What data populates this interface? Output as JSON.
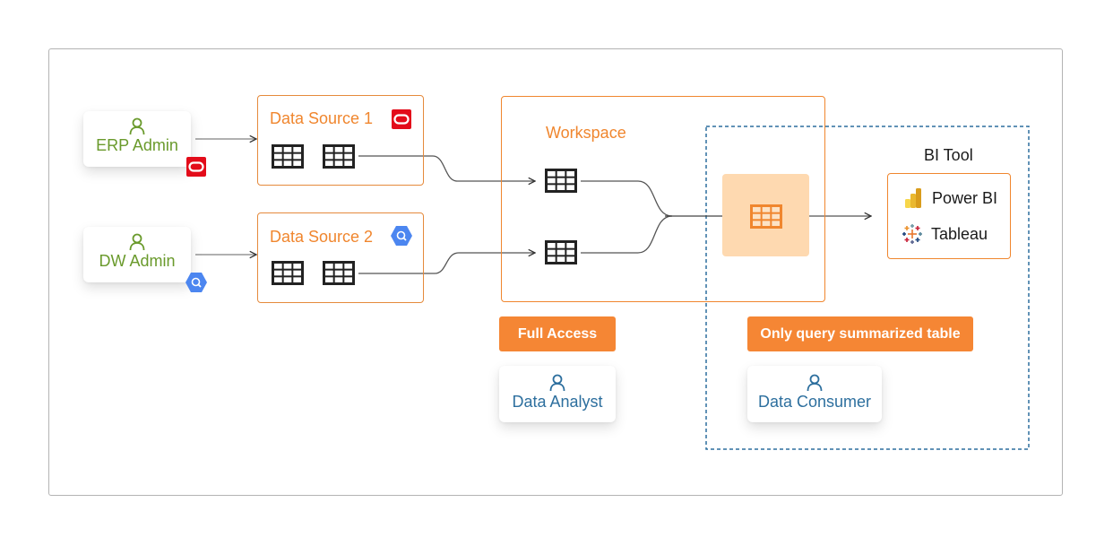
{
  "diagram": {
    "actors": {
      "erp_admin": {
        "label": "ERP Admin",
        "icon": "person-icon",
        "badge_icon": "oracle-logo-icon"
      },
      "dw_admin": {
        "label": "DW Admin",
        "icon": "person-icon",
        "badge_icon": "bigquery-logo-icon"
      },
      "data_analyst": {
        "label": "Data Analyst",
        "icon": "person-icon"
      },
      "data_consumer": {
        "label": "Data Consumer",
        "icon": "person-icon"
      }
    },
    "sources": [
      {
        "title": "Data Source 1",
        "logo": "oracle-logo-icon",
        "tables": 2
      },
      {
        "title": "Data Source 2",
        "logo": "bigquery-logo-icon",
        "tables": 2
      }
    ],
    "workspace": {
      "title": "Workspace",
      "tables": 2,
      "summary_table": "summarized-table"
    },
    "bi_tool": {
      "title": "BI Tool",
      "items": [
        {
          "label": "Power BI",
          "icon": "power-bi-icon"
        },
        {
          "label": "Tableau",
          "icon": "tableau-icon"
        }
      ]
    },
    "access_badges": {
      "full": "Full Access",
      "limited": "Only query summarized table"
    },
    "colors": {
      "orange": "#f0862e",
      "badge_orange": "#f58634",
      "summary_fill": "#fed9b0",
      "admin_green": "#6a9a2c",
      "user_blue": "#2d6f9e",
      "dashed_blue": "#2d6f9e",
      "oracle_red": "#e30c1a",
      "bigquery_blue": "#4c86f0"
    }
  }
}
